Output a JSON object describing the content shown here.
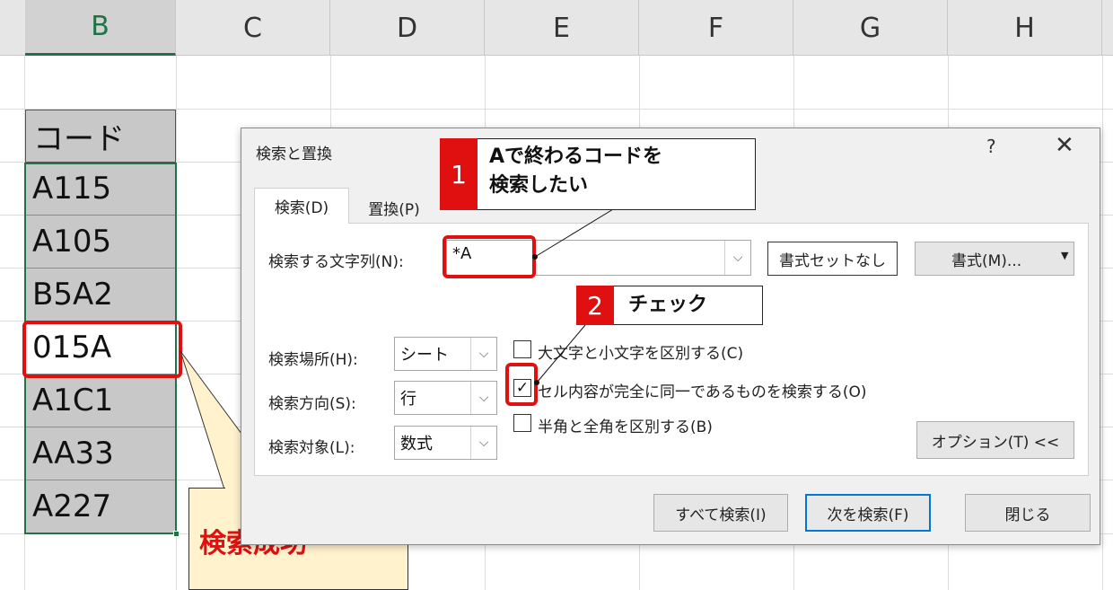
{
  "sheet": {
    "columns": [
      "B",
      "C",
      "D",
      "E",
      "F",
      "G",
      "H"
    ],
    "selected_column": "B",
    "header_cell": "コード",
    "cells": [
      "A115",
      "A105",
      "B5A2",
      "015A",
      "A1C1",
      "AA33",
      "A227"
    ],
    "found_cell": "015A"
  },
  "dialog": {
    "title": "検索と置換",
    "help_label": "?",
    "close_label": "✕",
    "tabs": [
      {
        "label": "検索(D)",
        "active": true
      },
      {
        "label": "置換(P)",
        "active": false
      }
    ],
    "find_label": "検索する文字列(N):",
    "find_value": "*A",
    "format_none_label": "書式セットなし",
    "format_label": "書式(M)...",
    "within_label": "検索場所(H):",
    "within_value": "シート",
    "search_label": "検索方向(S):",
    "search_value": "行",
    "lookin_label": "検索対象(L):",
    "lookin_value": "数式",
    "match_case_label": "大文字と小文字を区別する(C)",
    "match_case_checked": false,
    "match_entire_label": "セル内容が完全に同一であるものを検索する(O)",
    "match_entire_checked": true,
    "match_width_label": "半角と全角を区別する(B)",
    "match_width_checked": false,
    "options_label": "オプション(T) <<",
    "find_all_label": "すべて検索(I)",
    "find_next_label": "次を検索(F)",
    "close_button_label": "閉じる"
  },
  "annotations": {
    "callout1_number": "1",
    "callout1_text_line1": "Aで終わるコードを",
    "callout1_text_line2": "検索したい",
    "callout2_number": "2",
    "callout2_text": "チェック",
    "success_text": "検索成功"
  },
  "colors": {
    "excel_green": "#217346",
    "annotation_red": "#e01010",
    "success_bg": "#fff2cc",
    "dialog_default_button": "#0078d7"
  }
}
